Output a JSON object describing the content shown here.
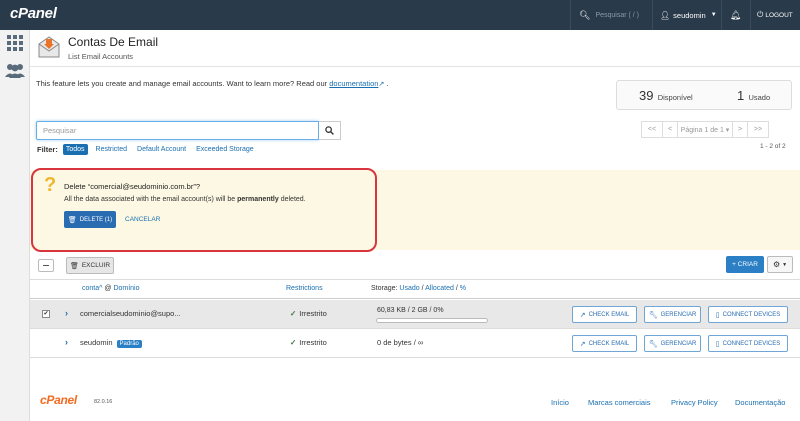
{
  "topbar": {
    "logo": "cPanel",
    "search_placeholder": "Pesquisar ( / )",
    "username": "seudomin",
    "logout": "LOGOUT"
  },
  "header": {
    "title": "Contas De Email",
    "subtitle": "List Email Accounts"
  },
  "intro": {
    "text": "This feature lets you create and manage email accounts. Want to learn more? Read our",
    "link": "documentation",
    "suffix": "."
  },
  "stats": {
    "available_num": "39",
    "available_label": "Disponível",
    "used_num": "1",
    "used_label": "Usado"
  },
  "search": {
    "placeholder": "Pesquisar"
  },
  "filter": {
    "label": "Filter:",
    "options": [
      "Todos",
      "Restricted",
      "Default Account",
      "Exceeded Storage"
    ]
  },
  "pager": {
    "first": "<<",
    "prev": "<",
    "page_label": "Página 1 de 1 ▾",
    "next": ">",
    "last": ">>",
    "count": "1 - 2 of 2"
  },
  "confirm": {
    "title": "Delete “comercial@seudominio.com.br”?",
    "text_pre": "All the data associated with the email account(s) will be ",
    "text_bold": "permanently",
    "text_post": " deleted.",
    "delete_btn": "DELETE (1)",
    "cancel_btn": "CANCELAR"
  },
  "toolbar": {
    "excluir": "EXCLUIR",
    "criar": "+ CRIAR"
  },
  "table": {
    "col_account": "conta",
    "col_at": "@",
    "col_domain": "Domínio",
    "col_restrictions": "Restrictions",
    "col_storage_prefix": "Storage:",
    "col_used": "Usado",
    "col_allocated": "Allocated",
    "col_percent": "%",
    "rows": [
      {
        "account": "comercialseudominio@supo...",
        "badge": "",
        "restriction": "Irrestrito",
        "storage": "60,83 KB / 2 GB / 0%",
        "usage_fraction": 0.0,
        "selected": true
      },
      {
        "account": "seudomin",
        "badge": "Padrão",
        "restriction": "Irrestrito",
        "storage": "0 de bytes / ∞",
        "selected": false
      }
    ],
    "actions": {
      "check_email": "CHECK EMAIL",
      "gerenciar": "GERENCIAR",
      "connect_devices": "CONNECT DEVICES"
    }
  },
  "footer": {
    "logo": "cPanel",
    "version": "82.0.16",
    "links": [
      "Início",
      "Marcas comerciais",
      "Privacy Policy",
      "Documentação"
    ]
  },
  "colors": {
    "topbar": "#293a4a",
    "primary": "#2a6cb2",
    "warning_bg": "#fcf8e3",
    "highlight": "#d9353e",
    "footer_logo": "#f26b21"
  }
}
